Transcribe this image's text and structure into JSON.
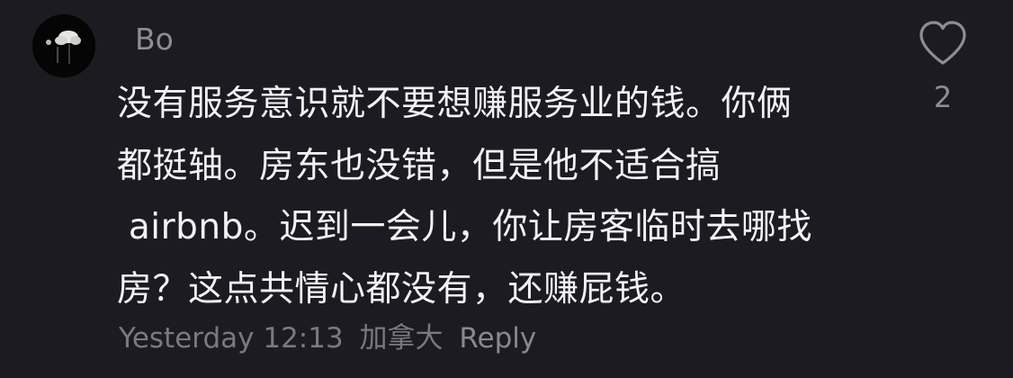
{
  "comment": {
    "username": "Bo",
    "lines": [
      "没有服务意识就不要想赚服务业的钱。你俩",
      "都挺轴。房东也没错，但是他不适合搞",
      " airbnb。迟到一会儿，你让房客临时去哪找",
      "房？这点共情心都没有，还赚屁钱。"
    ],
    "timestamp": "Yesterday 12:13",
    "location": "加拿大",
    "reply_label": "Reply",
    "like_count": "2",
    "like_icon": "heart-outline-icon",
    "avatar_icon": "avatar-icon"
  }
}
